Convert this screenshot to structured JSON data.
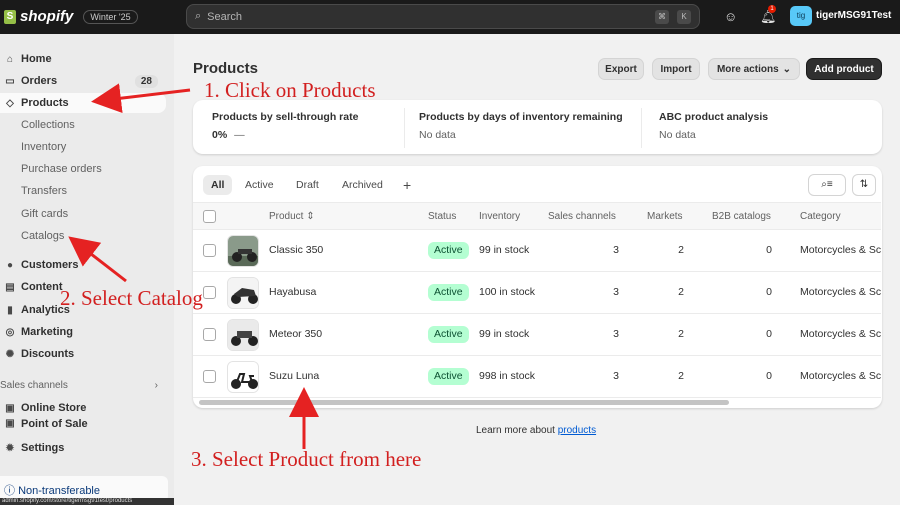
{
  "topbar": {
    "brand": "shopify",
    "version": "Winter '25",
    "search_placeholder": "Search",
    "shortcut_keys": [
      "⌘",
      "K"
    ],
    "notification_count": "1",
    "avatar_initials": "tig",
    "username": "tigerMSG91Test"
  },
  "sidebar": {
    "home": "Home",
    "orders": "Orders",
    "orders_count": "28",
    "products": "Products",
    "collections": "Collections",
    "inventory": "Inventory",
    "purchase_orders": "Purchase orders",
    "transfers": "Transfers",
    "gift_cards": "Gift cards",
    "catalogs": "Catalogs",
    "customers": "Customers",
    "content": "Content",
    "analytics": "Analytics",
    "marketing": "Marketing",
    "discounts": "Discounts",
    "sales_channels": "Sales channels",
    "online_store": "Online Store",
    "point_of_sale": "Point of Sale",
    "settings": "Settings",
    "non_transferable": "Non-transferable",
    "status_url": "admin.shopify.com/store/tigermsg91test/products"
  },
  "page": {
    "title": "Products",
    "export": "Export",
    "import": "Import",
    "more_actions": "More actions",
    "add_product": "Add product"
  },
  "metrics": [
    {
      "title": "Products by sell-through rate",
      "value": "0%",
      "sub": "—"
    },
    {
      "title": "Products by days of inventory remaining",
      "value": "No data"
    },
    {
      "title": "ABC product analysis",
      "value": "No data"
    }
  ],
  "tabs": [
    "All",
    "Active",
    "Draft",
    "Archived",
    "+"
  ],
  "columns": {
    "product": "Product",
    "status": "Status",
    "inventory": "Inventory",
    "sales_channels": "Sales channels",
    "markets": "Markets",
    "b2b": "B2B catalogs",
    "category": "Category"
  },
  "rows": [
    {
      "name": "Classic 350",
      "status": "Active",
      "inventory": "99 in stock",
      "channels": "3",
      "markets": "2",
      "b2b": "0",
      "category": "Motorcycles & Sc"
    },
    {
      "name": "Hayabusa",
      "status": "Active",
      "inventory": "100 in stock",
      "channels": "3",
      "markets": "2",
      "b2b": "0",
      "category": "Motorcycles & Sc"
    },
    {
      "name": "Meteor 350",
      "status": "Active",
      "inventory": "99 in stock",
      "channels": "3",
      "markets": "2",
      "b2b": "0",
      "category": "Motorcycles & Sc"
    },
    {
      "name": "Suzu Luna",
      "status": "Active",
      "inventory": "998 in stock",
      "channels": "3",
      "markets": "2",
      "b2b": "0",
      "category": "Motorcycles & Sc"
    }
  ],
  "learn_more": {
    "prefix": "Learn more about ",
    "link": "products"
  },
  "annotations": {
    "step1": "1. Click on Products",
    "step2": "2. Select Catalog",
    "step3": "3. Select Product from here",
    "color": "#d21f1f"
  }
}
